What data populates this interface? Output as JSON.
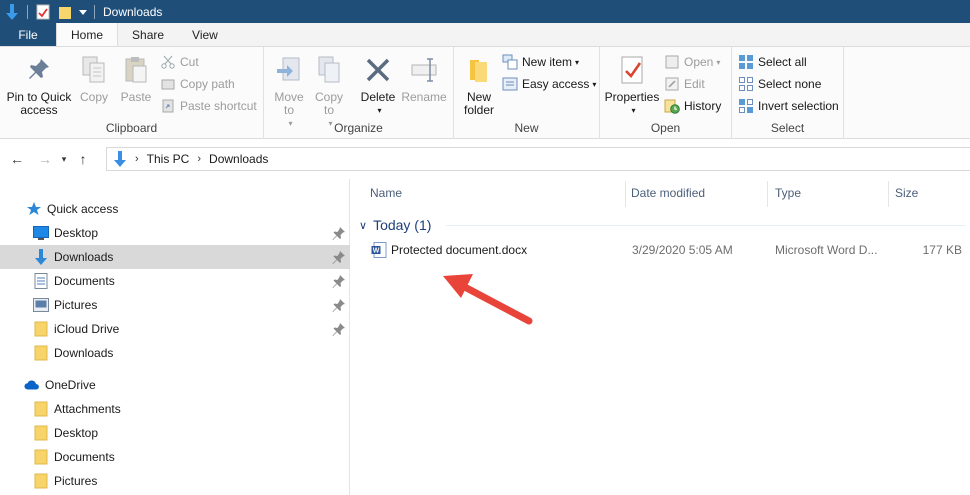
{
  "window": {
    "title": "Downloads"
  },
  "ribbon_tabs": {
    "file": "File",
    "home": "Home",
    "share": "Share",
    "view": "View"
  },
  "clipboard": {
    "label": "Clipboard",
    "pin": "Pin to Quick access",
    "copy": "Copy",
    "paste": "Paste",
    "cut": "Cut",
    "copy_path": "Copy path",
    "paste_shortcut": "Paste shortcut"
  },
  "organize": {
    "label": "Organize",
    "move_to": "Move to",
    "copy_to": "Copy to",
    "delete": "Delete",
    "rename": "Rename"
  },
  "new": {
    "label": "New",
    "new_folder": "New folder",
    "new_item": "New item",
    "easy_access": "Easy access"
  },
  "open": {
    "label": "Open",
    "properties": "Properties",
    "open": "Open",
    "edit": "Edit",
    "history": "History"
  },
  "select": {
    "label": "Select",
    "select_all": "Select all",
    "select_none": "Select none",
    "invert": "Invert selection"
  },
  "address": {
    "crumbs": [
      "This PC",
      "Downloads"
    ]
  },
  "nav": {
    "quick_access": "Quick access",
    "items": [
      {
        "label": "Desktop",
        "pinned": true
      },
      {
        "label": "Downloads",
        "pinned": true,
        "selected": true
      },
      {
        "label": "Documents",
        "pinned": true
      },
      {
        "label": "Pictures",
        "pinned": true
      },
      {
        "label": "iCloud Drive",
        "pinned": true
      },
      {
        "label": "Downloads",
        "pinned": false
      }
    ],
    "onedrive": "OneDrive",
    "onedrive_items": [
      {
        "label": "Attachments"
      },
      {
        "label": "Desktop"
      },
      {
        "label": "Documents"
      },
      {
        "label": "Pictures"
      }
    ]
  },
  "columns": {
    "name": "Name",
    "date": "Date modified",
    "type": "Type",
    "size": "Size"
  },
  "group": {
    "label": "Today (1)"
  },
  "files": [
    {
      "name": "Protected document.docx",
      "date": "3/29/2020 5:05 AM",
      "type": "Microsoft Word D...",
      "size": "177 KB"
    }
  ],
  "colors": {
    "titlebar": "#1f4e79",
    "accent": "#0078d7",
    "arrow": "#e8443a"
  }
}
